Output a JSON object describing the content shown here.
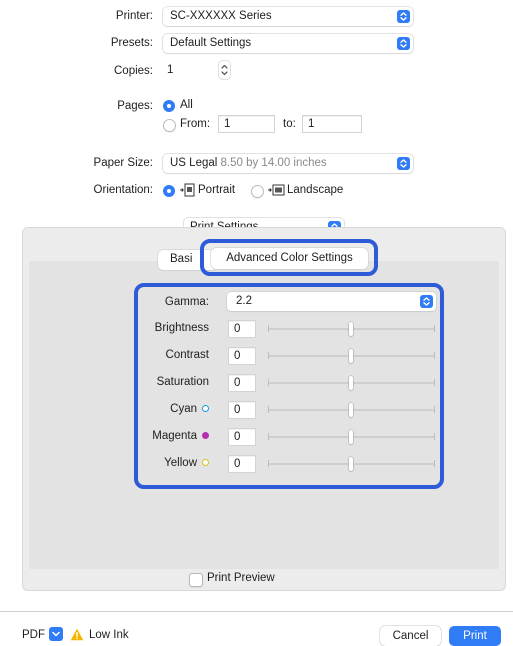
{
  "printer": {
    "label": "Printer:",
    "value": "SC-XXXXXX Series"
  },
  "presets": {
    "label": "Presets:",
    "value": "Default Settings"
  },
  "copies": {
    "label": "Copies:",
    "value": "1"
  },
  "pages": {
    "label": "Pages:",
    "all_label": "All",
    "from_label": "From:",
    "from_value": "1",
    "to_label": "to:",
    "to_value": "1"
  },
  "paper_size": {
    "label": "Paper Size:",
    "value": "US Legal",
    "detail": "8.50 by 14.00 inches"
  },
  "orientation": {
    "label": "Orientation:",
    "portrait_label": "Portrait",
    "landscape_label": "Landscape",
    "selected": "Portrait"
  },
  "section_popup": {
    "value": "Print Settings"
  },
  "tabs": {
    "basic_label": "Basi",
    "advanced_label": "Advanced Color Settings",
    "selected": "Advanced Color Settings"
  },
  "advanced": {
    "gamma_label": "Gamma:",
    "gamma_value": "2.2",
    "sliders": [
      {
        "label": "Brightness",
        "value": "0",
        "level": 0.5
      },
      {
        "label": "Contrast",
        "value": "0",
        "level": 0.5
      },
      {
        "label": "Saturation",
        "value": "0",
        "level": 0.5
      },
      {
        "label": "Cyan",
        "value": "0",
        "level": 0.5,
        "dot_color": "#1a9be0",
        "dot_style": "ring"
      },
      {
        "label": "Magenta",
        "value": "0",
        "level": 0.5,
        "dot_color": "#b52fae",
        "dot_style": "filled"
      },
      {
        "label": "Yellow",
        "value": "0",
        "level": 0.5,
        "dot_color": "#d6c21a",
        "dot_style": "ring"
      }
    ]
  },
  "print_preview": {
    "label": "Print Preview",
    "checked": false
  },
  "footer": {
    "pdf_label": "PDF",
    "warning_label": "Low Ink",
    "cancel_label": "Cancel",
    "print_label": "Print"
  },
  "colors": {
    "accent": "#2f7cf6",
    "highlight": "#2e5bd8",
    "warning": "#f2b600"
  }
}
